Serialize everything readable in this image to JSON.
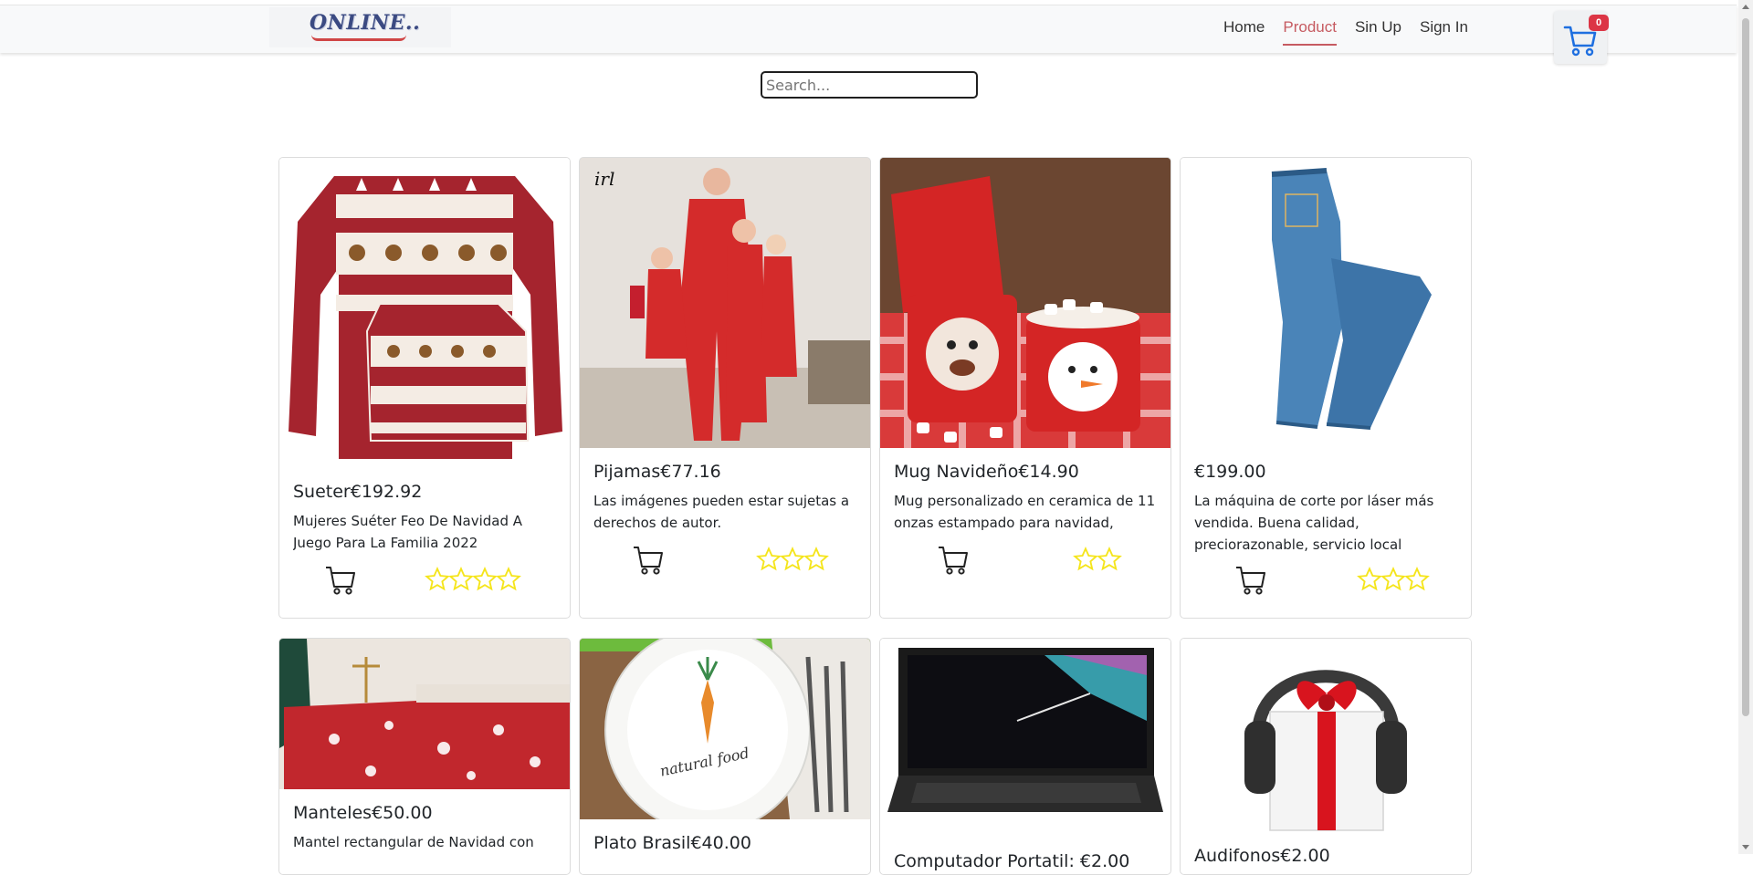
{
  "brand": {
    "logo_text": "ONLINE.."
  },
  "nav": [
    {
      "label": "Home",
      "active": false
    },
    {
      "label": "Product",
      "active": true
    },
    {
      "label": "Sin Up",
      "active": false
    },
    {
      "label": "Sign In",
      "active": false
    }
  ],
  "cart": {
    "count": "0",
    "icon": "cart-icon"
  },
  "search": {
    "placeholder": "Search..."
  },
  "colors": {
    "accent": "#c65b61",
    "badge": "#dc3545",
    "star": "#f5e51b",
    "cart_blue": "#1e6fe0"
  },
  "products": [
    {
      "title": "Sueter€192.92",
      "description": "Mujeres Suéter Feo De Navidad A Juego Para La Familia 2022",
      "stars": 4,
      "image": "sweater-image"
    },
    {
      "title": "Pijamas€77.16",
      "description": "Las imágenes pueden estar sujetas a derechos de autor.",
      "stars": 3,
      "image": "pajamas-image",
      "image_caption": "irl"
    },
    {
      "title": "Mug Navideño€14.90",
      "description": "Mug personalizado en ceramica de 11 onzas estampado para navidad,",
      "stars": 2,
      "image": "mugs-image"
    },
    {
      "title": "€199.00",
      "description": "La máquina de corte por láser más vendida. Buena calidad, preciorazonable, servicio local",
      "stars": 3,
      "image": "jeans-image"
    },
    {
      "title": "Manteles€50.00",
      "description": "Mantel rectangular de Navidad con",
      "stars": 0,
      "image": "tablecloth-image"
    },
    {
      "title": "Plato Brasil€40.00",
      "description": "",
      "stars": 0,
      "image": "plate-image",
      "image_caption": "natural food"
    },
    {
      "title": "Computador Portatil: €2.00",
      "description": "",
      "stars": 0,
      "image": "laptop-image"
    },
    {
      "title": "Audifonos€2.00",
      "description": "",
      "stars": 0,
      "image": "headphones-gift-image"
    }
  ]
}
